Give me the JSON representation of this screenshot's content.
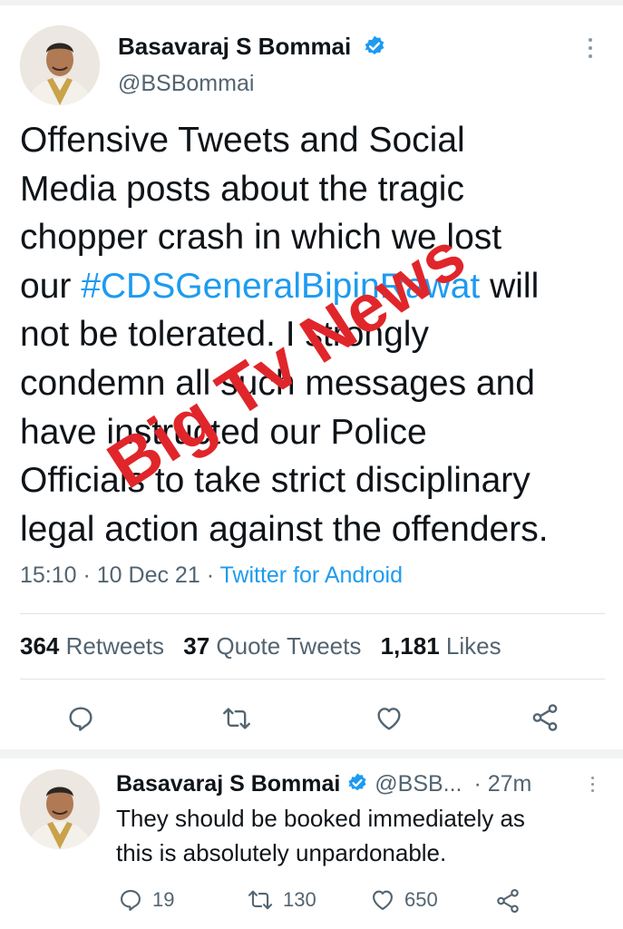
{
  "tweet": {
    "author_name": "Basavaraj S Bommai",
    "author_handle": "@BSBommai",
    "body_lines": [
      "Offensive Tweets and Social",
      "Media posts about the tragic",
      "chopper crash in which we lost",
      "our ",
      "#CDSGeneralBipinRawat",
      " will",
      "not be tolerated. I strongly",
      "condemn all such messages and",
      "have instructed our Police",
      "Officials to take strict disciplinary",
      "legal action against the offenders."
    ],
    "timestamp": "15:10 · 10 Dec 21 · ",
    "source": "Twitter for Android",
    "stats": {
      "retweets_count": "364",
      "retweets_label": "Retweets",
      "quote_count": "37",
      "quote_label": "Quote Tweets",
      "likes_count": "1,181",
      "likes_label": "Likes"
    }
  },
  "actions": {
    "icons": [
      "reply-icon",
      "retweet-icon",
      "like-icon",
      "share-icon"
    ]
  },
  "reply": {
    "author_name": "Basavaraj S Bommai",
    "author_handle": "@BSB...",
    "time": "· 27m",
    "text_lines": [
      "They should be booked immediately as",
      "this is absolutely unpardonable."
    ],
    "reply_count": "19",
    "retweet_count": "130",
    "like_count": "650"
  },
  "watermark": "Big Tv News",
  "colors": {
    "accent": "#1d9bf0",
    "text": "#0f1419",
    "secondary": "#536471",
    "watermark": "#e0262b"
  }
}
